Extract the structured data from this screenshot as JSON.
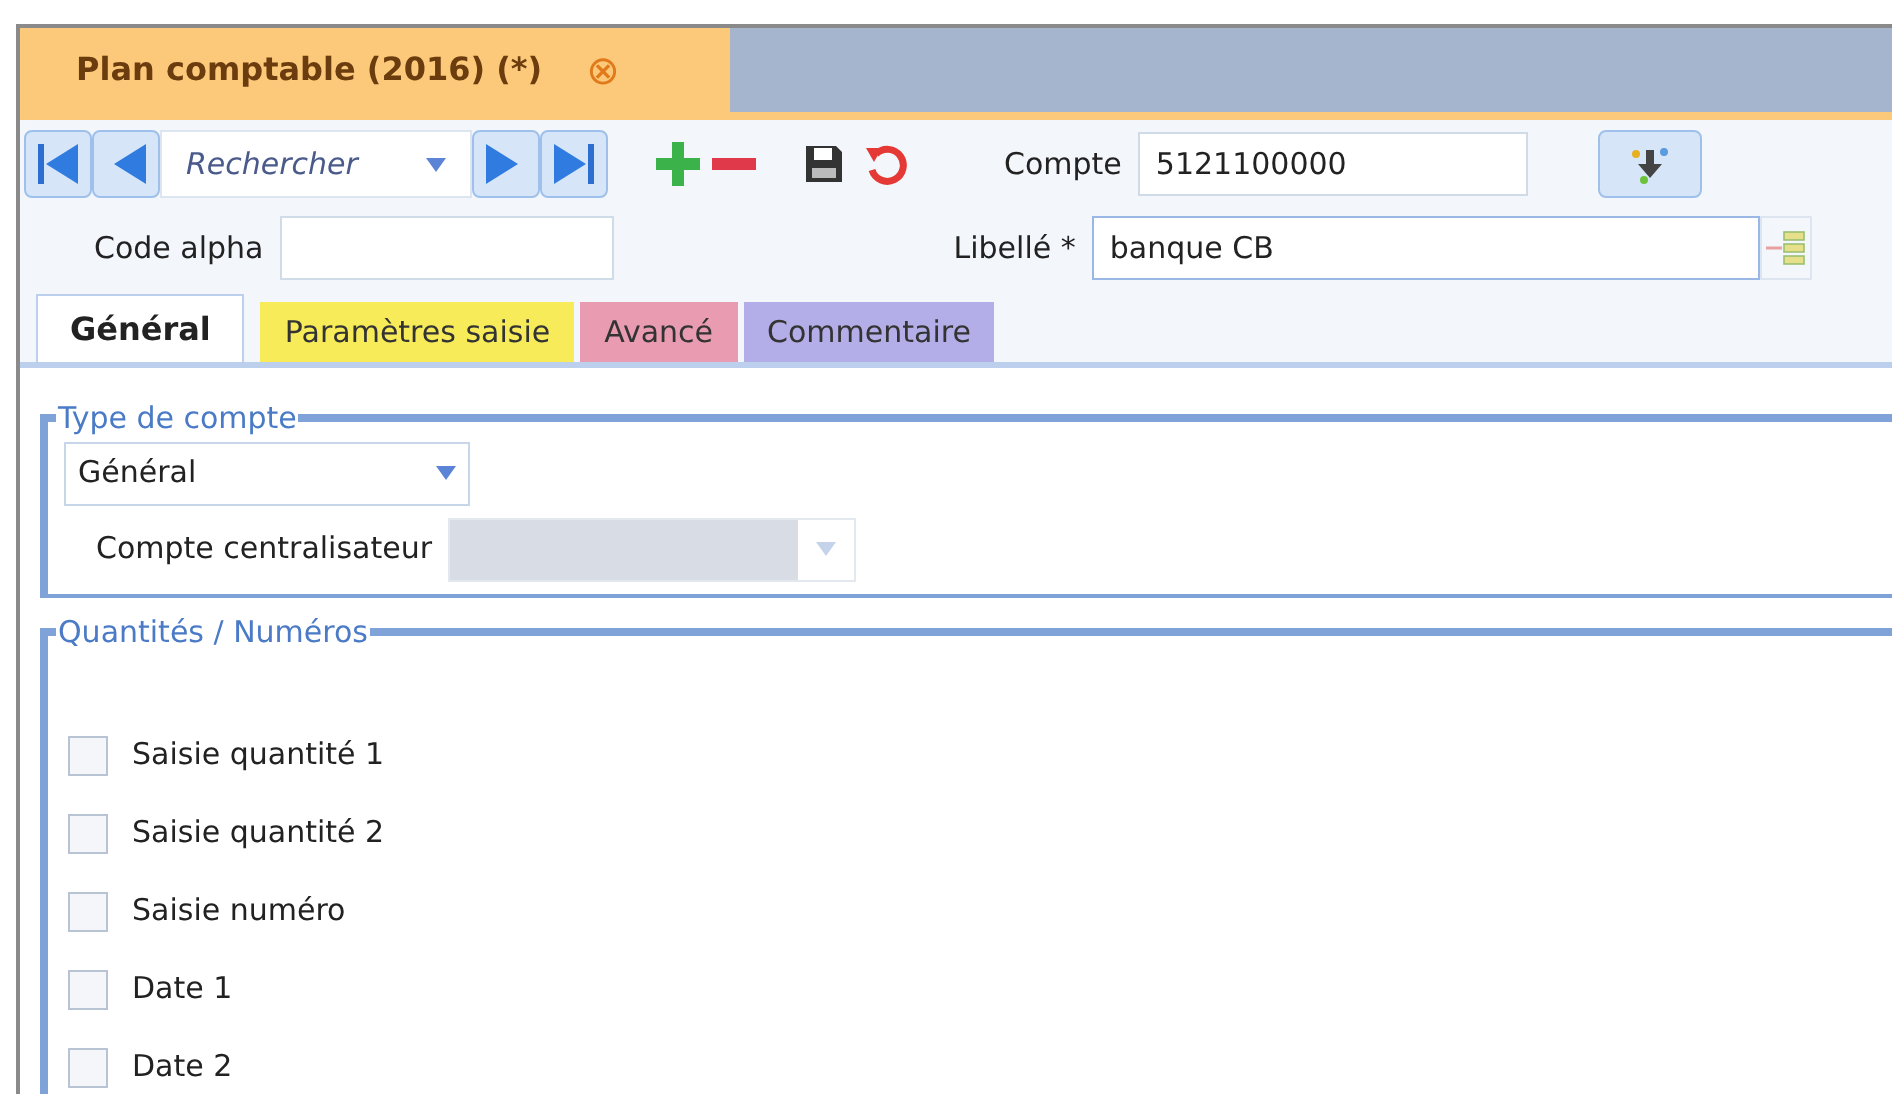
{
  "document_tab": {
    "title": "Plan comptable (2016) (*)",
    "close": "⊗"
  },
  "toolbar": {
    "search_placeholder": "Rechercher"
  },
  "fields": {
    "compte": {
      "label": "Compte",
      "value": "5121100000"
    },
    "code_alpha": {
      "label": "Code alpha"
    },
    "libelle": {
      "label": "Libellé *",
      "value": "banque CB"
    }
  },
  "tabs": [
    {
      "label": "Général",
      "selected": true,
      "color": "#ffffff"
    },
    {
      "label": "Paramètres saisie",
      "selected": false,
      "color": "#f7eb5a"
    },
    {
      "label": "Avancé",
      "selected": false,
      "color": "#e99bb2"
    },
    {
      "label": "Commentaire",
      "selected": false,
      "color": "#b3aee8"
    }
  ],
  "type_de_compte": {
    "legend": "Type de compte",
    "value": "Général",
    "centralisateur": {
      "label": "Compte centralisateur",
      "disabled": true
    }
  },
  "quantites": {
    "legend": "Quantités / Numéros",
    "options": [
      {
        "label": "Saisie quantité 1",
        "checked": false
      },
      {
        "label": "Saisie quantité 2",
        "checked": false
      },
      {
        "label": "Saisie numéro",
        "checked": false
      },
      {
        "label": "Date 1",
        "checked": false
      },
      {
        "label": "Date 2",
        "checked": false
      }
    ]
  }
}
